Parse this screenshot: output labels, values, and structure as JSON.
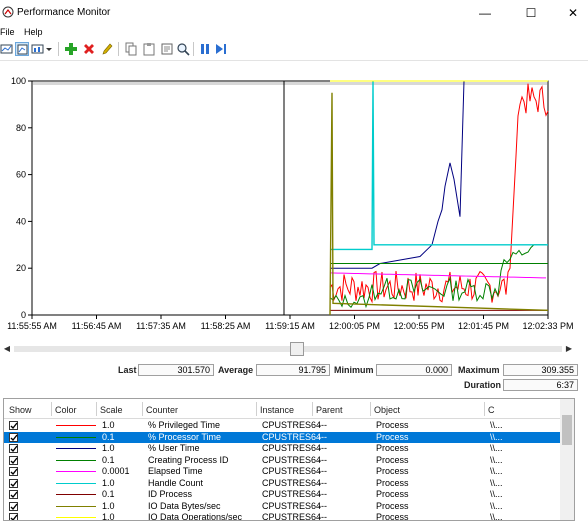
{
  "window": {
    "title": "Performance Monitor",
    "minimize": "—",
    "maximize": "☐",
    "close": "✕"
  },
  "menu": [
    {
      "label": "File"
    },
    {
      "label": "Help"
    }
  ],
  "toolbar_icons": [
    "view-current-activity-icon",
    "view-log-data-icon",
    "change-graph-type-icon",
    "dropdown-icon",
    "add-counter-icon",
    "delete-counter-icon",
    "highlight-icon",
    "copy-properties-icon",
    "paste-counter-list-icon",
    "properties-icon",
    "zoom-icon",
    "freeze-display-icon",
    "update-data-icon"
  ],
  "chart_data": {
    "type": "line",
    "ylim": [
      0,
      100
    ],
    "y_ticks": [
      "100",
      "80",
      "60",
      "40",
      "20",
      "0"
    ],
    "x_ticks": [
      "11:55:55 AM",
      "11:56:45 AM",
      "11:57:35 AM",
      "11:58:25 AM",
      "11:59:15 AM",
      "12:00:05 PM",
      "12:00:55 PM",
      "12:01:45 PM",
      "12:02:33 PM"
    ],
    "grid": false,
    "series": [
      {
        "name": "% Privileged Time",
        "color": "#ff0000"
      },
      {
        "name": "% Processor Time",
        "color": "#008000"
      },
      {
        "name": "% User Time",
        "color": "#000080"
      },
      {
        "name": "Creating Process ID",
        "color": "#008000"
      },
      {
        "name": "Elapsed Time",
        "color": "#ff00ff"
      },
      {
        "name": "Handle Count",
        "color": "#00cccc"
      },
      {
        "name": "ID Process",
        "color": "#800000"
      },
      {
        "name": "IO Data Bytes/sec",
        "color": "#808000"
      },
      {
        "name": "IO Data Operations/sec",
        "color": "#ffff00"
      }
    ]
  },
  "stats": {
    "last_label": "Last",
    "last_value": "301.570",
    "average_label": "Average",
    "average_value": "91.795",
    "minimum_label": "Minimum",
    "minimum_value": "0.000",
    "maximum_label": "Maximum",
    "maximum_value": "309.355",
    "duration_label": "Duration",
    "duration_value": "6:37"
  },
  "legend": {
    "headers": {
      "show": "Show",
      "color": "Color",
      "scale": "Scale",
      "counter": "Counter",
      "instance": "Instance",
      "parent": "Parent",
      "object": "Object",
      "computer": "C"
    },
    "rows": [
      {
        "color": "#ff0000",
        "scale": "1.0",
        "counter": "% Privileged Time",
        "instance": "CPUSTRES64",
        "parent": "---",
        "object": "Process",
        "computer": "\\\\..."
      },
      {
        "color": "#008000",
        "scale": "0.1",
        "counter": "% Processor Time",
        "instance": "CPUSTRES64",
        "parent": "---",
        "object": "Process",
        "computer": "\\\\...",
        "selected": true
      },
      {
        "color": "#000080",
        "scale": "1.0",
        "counter": "% User Time",
        "instance": "CPUSTRES64",
        "parent": "---",
        "object": "Process",
        "computer": "\\\\..."
      },
      {
        "color": "#008000",
        "scale": "0.1",
        "counter": "Creating Process ID",
        "instance": "CPUSTRES64",
        "parent": "---",
        "object": "Process",
        "computer": "\\\\..."
      },
      {
        "color": "#ff00ff",
        "scale": "0.0001",
        "counter": "Elapsed Time",
        "instance": "CPUSTRES64",
        "parent": "---",
        "object": "Process",
        "computer": "\\\\..."
      },
      {
        "color": "#00cccc",
        "scale": "1.0",
        "counter": "Handle Count",
        "instance": "CPUSTRES64",
        "parent": "---",
        "object": "Process",
        "computer": "\\\\..."
      },
      {
        "color": "#800000",
        "scale": "0.1",
        "counter": "ID Process",
        "instance": "CPUSTRES64",
        "parent": "---",
        "object": "Process",
        "computer": "\\\\..."
      },
      {
        "color": "#808000",
        "scale": "1.0",
        "counter": "IO Data Bytes/sec",
        "instance": "CPUSTRES64",
        "parent": "---",
        "object": "Process",
        "computer": "\\\\..."
      },
      {
        "color": "#ffff00",
        "scale": "1.0",
        "counter": "IO Data Operations/sec",
        "instance": "CPUSTRES64",
        "parent": "---",
        "object": "Process",
        "computer": "\\\\..."
      }
    ]
  }
}
